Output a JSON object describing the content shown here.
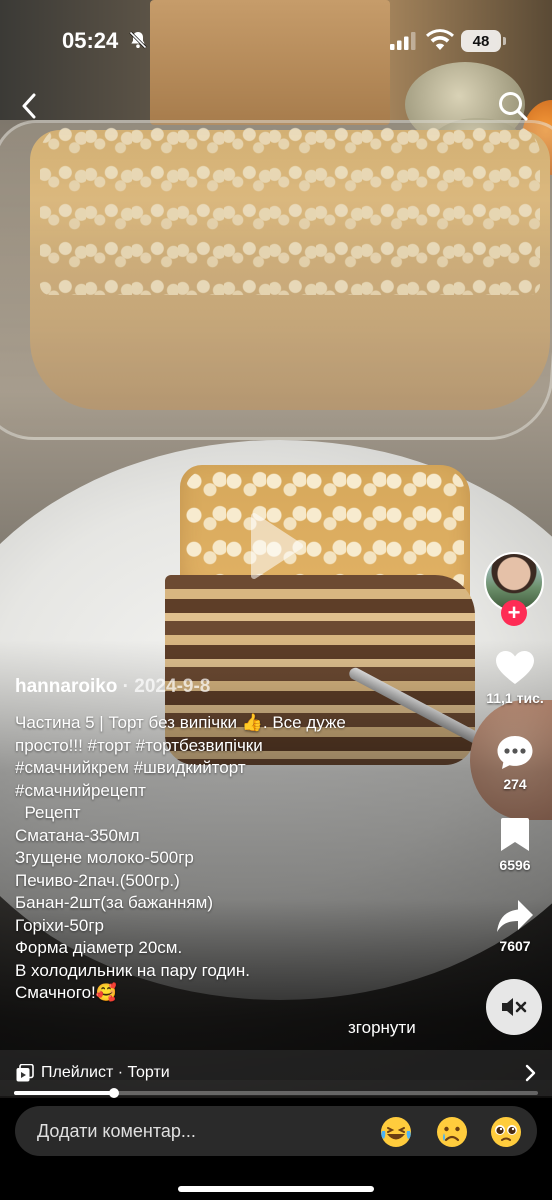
{
  "status_bar": {
    "time": "05:24",
    "battery": "48",
    "icons": [
      "bell-slash-icon",
      "signal-icon",
      "wifi-icon",
      "battery-icon"
    ]
  },
  "nav": {
    "back_icon": "chevron-left-icon",
    "search_icon": "search-icon"
  },
  "author": {
    "name": "hannaroiko",
    "separator": " · ",
    "date": "2024-9-8"
  },
  "caption": [
    "Частина 5 | Торт без випічки 👍. Все дуже",
    "просто!!! #торт #тортбезвипічки",
    "#смачнийкрем #швидкийторт",
    "#смачнийрецепт",
    "  Рецепт",
    "Сматана-350мл",
    "Згущене молоко-500гр",
    "Печиво-2пач.(500гр.)",
    "Банан-2шт(за бажанням)",
    "Горіхи-50гр",
    "Форма діаметр 20см.",
    "В холодильник на пару годин.",
    "Смачного!🥰"
  ],
  "collapse_label": "згорнути",
  "actions": {
    "likes": "11,1 тис.",
    "comments": "274",
    "saves": "6596",
    "shares": "7607"
  },
  "playlist": {
    "label": "Плейлист · Торти"
  },
  "progress": {
    "fraction": 0.19
  },
  "comment_input": {
    "placeholder": "Додати коментар..."
  },
  "emojis": [
    "😂",
    "😢",
    "🥺"
  ],
  "colors": {
    "accent": "#fe2c55",
    "input_bg": "#2a2a2a"
  }
}
